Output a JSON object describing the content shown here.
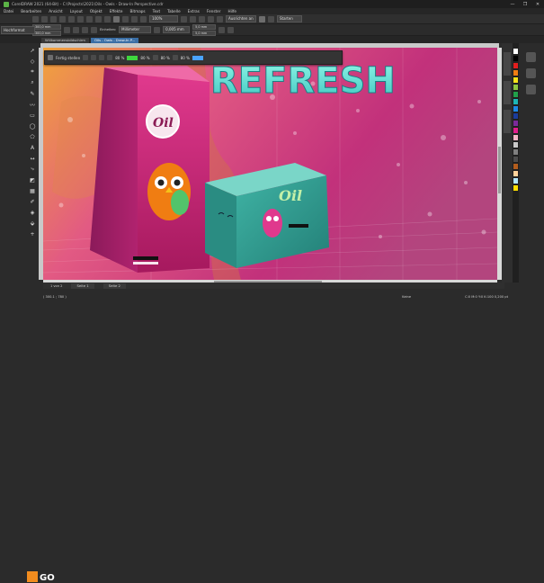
{
  "window": {
    "title": "CorelDRAW 2021 (64-Bit) - C:\\Projects\\2021\\Oils - Owls - Draw-In Perspective.cdr",
    "controls": [
      "—",
      "❐",
      "✕"
    ]
  },
  "menu": [
    "Datei",
    "Bearbeiten",
    "Ansicht",
    "Layout",
    "Objekt",
    "Effekte",
    "Bitmaps",
    "Text",
    "Tabelle",
    "Extras",
    "Fenster",
    "Hilfe"
  ],
  "toolbar1": {
    "zoom": "100%",
    "snap_label": "Ausrichten an",
    "start_label": "Starten"
  },
  "toolbar2": {
    "preset": "Hochformat",
    "width": "300,0 mm",
    "height": "300,0 mm",
    "units_label": "Einheiten:",
    "units_value": "Millimeter",
    "nudge": "0,005 mm",
    "dup_x": "5,0 mm",
    "dup_y": "5,0 mm"
  },
  "tabs": [
    {
      "label": "Willkommensbildschirm",
      "active": false
    },
    {
      "label": "Oils - Owls - Draw-In P...",
      "active": true
    }
  ],
  "perspective_toolbar": {
    "title": "Fertig stellen",
    "opacity_values": [
      "80 %",
      "80 %",
      "80 %",
      "80 %"
    ],
    "swatch_colors": [
      "#3ed63e",
      "#4aa3ff"
    ]
  },
  "artwork": {
    "headline": "REFRESH",
    "bag_logo": "Oil",
    "box_logo": "Oil"
  },
  "pages": {
    "counter": "1 von 2",
    "page1": "Seite 1",
    "page2": "Seite 2"
  },
  "status": {
    "left": "( 300.1 ; 780 )",
    "fill_label": "Keine",
    "right": "C:0 M:0 Y:0 K:100  0,200 pt"
  },
  "branding": {
    "logo_text": "GO"
  },
  "palette_colors": [
    "#ffffff",
    "#000000",
    "#e21d1d",
    "#f07d12",
    "#f6e21a",
    "#8ec63f",
    "#21a04a",
    "#1db6b6",
    "#1e88e5",
    "#1a3c9c",
    "#7b2a9b",
    "#e11d8c",
    "#f5b6c8",
    "#c9c9c9",
    "#7f7f7f",
    "#4d4d4d",
    "#b35d1d",
    "#ffd29b",
    "#b2e6ff",
    "#ffdf00"
  ]
}
